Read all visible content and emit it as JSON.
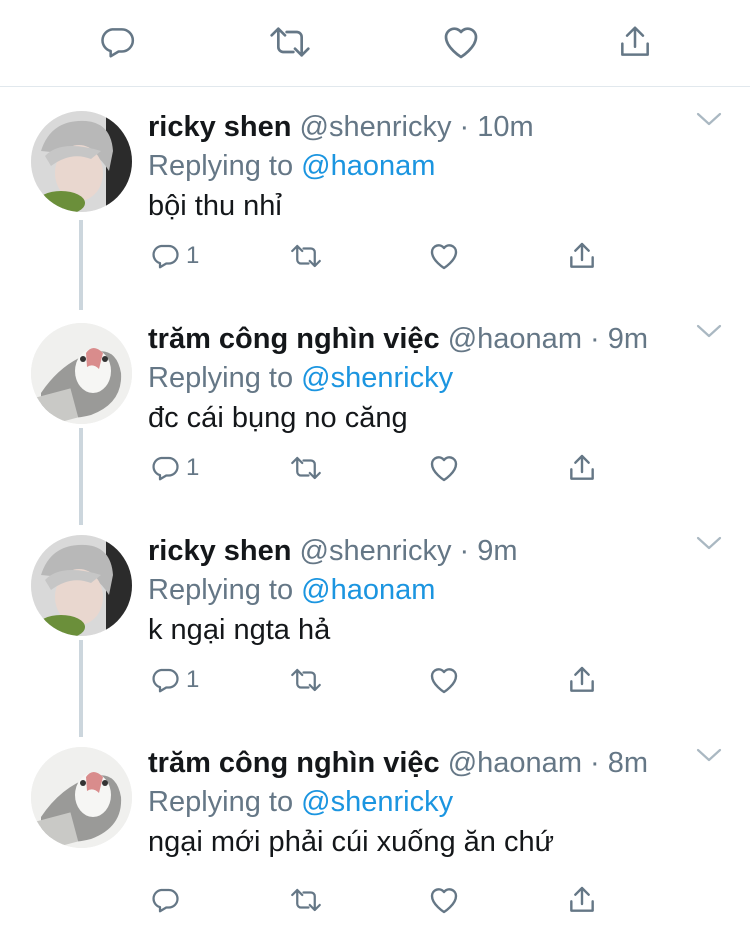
{
  "top_actions": [
    {
      "name": "reply-icon"
    },
    {
      "name": "retweet-icon"
    },
    {
      "name": "like-icon"
    },
    {
      "name": "share-icon"
    }
  ],
  "tweets": [
    {
      "name": "ricky shen",
      "handle": "@shenricky",
      "dot": "·",
      "time": "10m",
      "replying_prefix": "Replying to ",
      "replying_to": "@haonam",
      "text": "bội thu nhỉ",
      "reply_count": "1",
      "avatar": "ricky-avatar"
    },
    {
      "name": "trăm công nghìn việc",
      "handle": "@haonam",
      "dot": "·",
      "time": "9m",
      "replying_prefix": "Replying to ",
      "replying_to": "@shenricky",
      "text": "đc cái bụng no căng",
      "reply_count": "1",
      "avatar": "haonam-avatar"
    },
    {
      "name": "ricky shen",
      "handle": "@shenricky",
      "dot": "·",
      "time": "9m",
      "replying_prefix": "Replying to ",
      "replying_to": "@haonam",
      "text": "k ngại ngta hả",
      "reply_count": "1",
      "avatar": "ricky-avatar"
    },
    {
      "name": "trăm công nghìn việc",
      "handle": "@haonam",
      "dot": "·",
      "time": "8m",
      "replying_prefix": "Replying to ",
      "replying_to": "@shenricky",
      "text": "ngại mới phải cúi xuống ăn chứ",
      "reply_count": "",
      "avatar": "haonam-avatar"
    }
  ],
  "colors": {
    "text": "#14171a",
    "secondary": "#657786",
    "link": "#1b95e0",
    "divider": "#e1e8ed",
    "thread_line": "#ccd6dd"
  }
}
